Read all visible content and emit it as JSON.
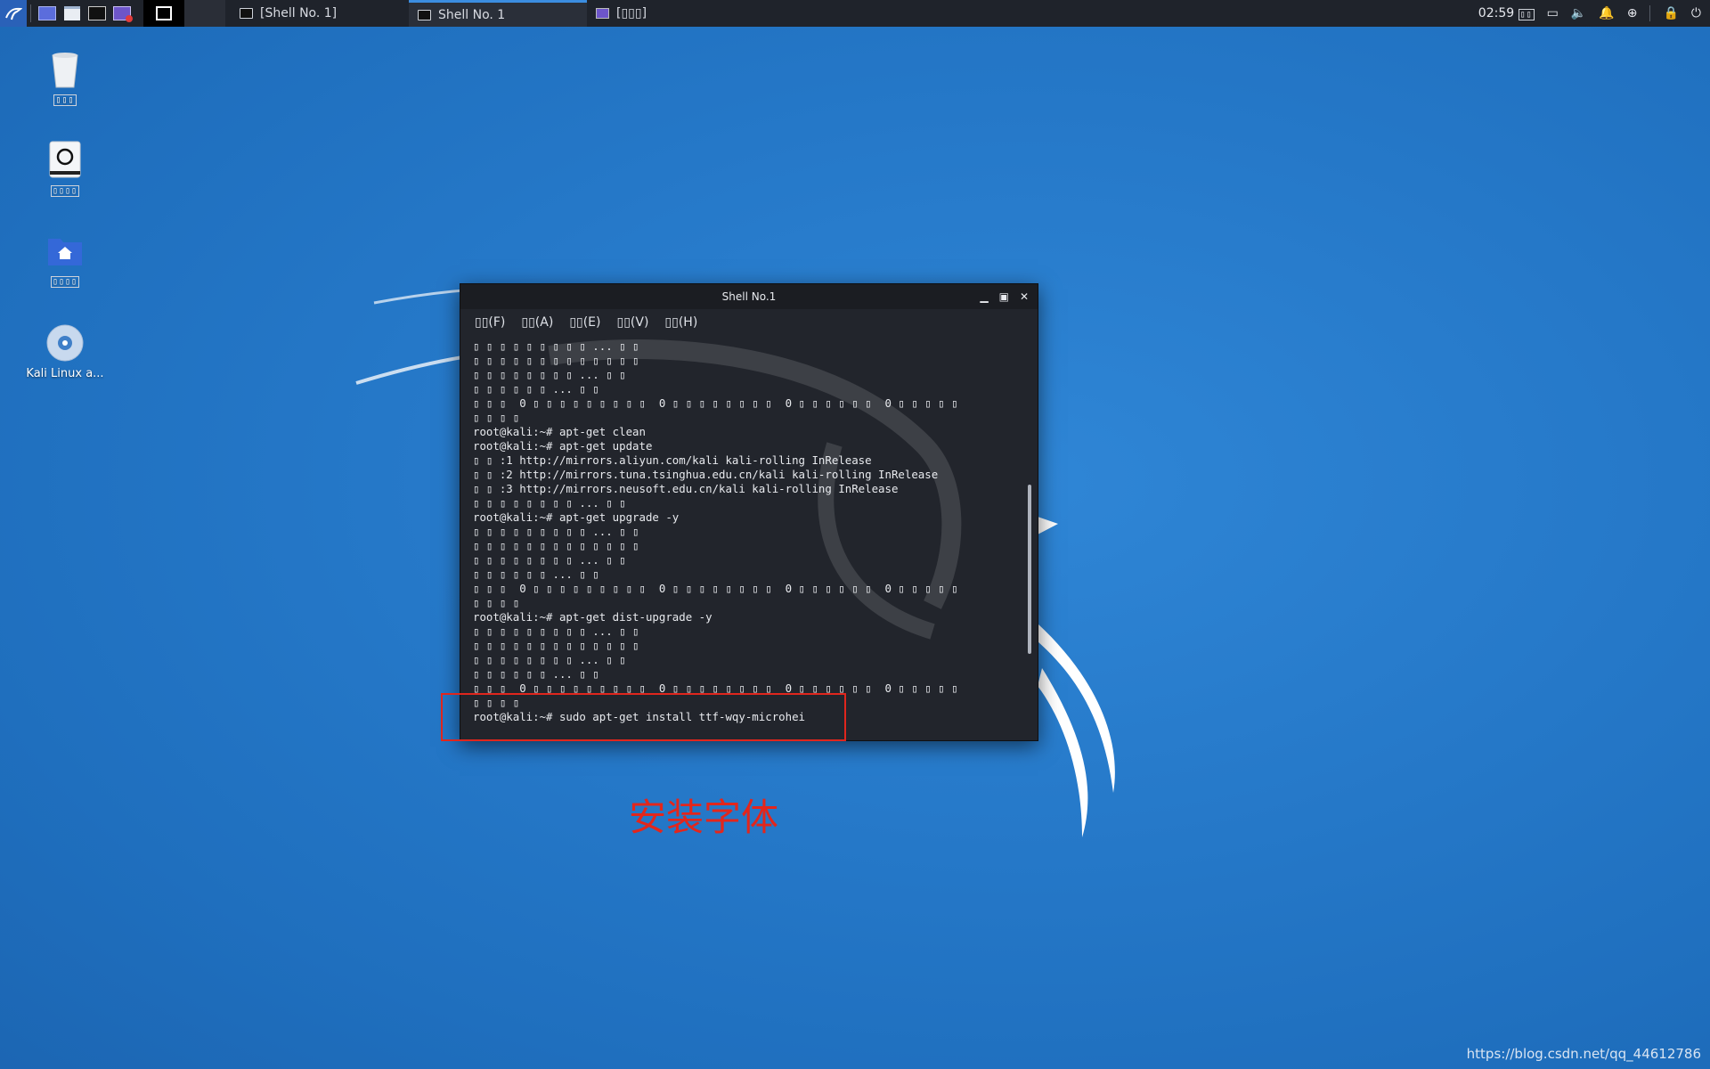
{
  "topbar": {
    "tasks": [
      {
        "label": "[Shell No. 1]",
        "icon": "terminal-icon"
      },
      {
        "label": "Shell No. 1",
        "icon": "terminal-icon"
      },
      {
        "label": "[▯▯▯]",
        "icon": "screen-icon"
      }
    ],
    "clock": "02:59",
    "clock_suffix": "▯▯"
  },
  "desktop": {
    "icons": [
      {
        "label": "▯▯▯",
        "icon": "trash-icon"
      },
      {
        "label": "▯▯▯▯",
        "icon": "drive-icon"
      },
      {
        "label": "▯▯▯▯",
        "icon": "home-folder-icon"
      },
      {
        "label": "Kali Linux a...",
        "icon": "disc-icon"
      }
    ]
  },
  "terminal": {
    "title": "Shell No.1",
    "menu": [
      "▯▯(F)",
      "▯▯(A)",
      "▯▯(E)",
      "▯▯(V)",
      "▯▯(H)"
    ],
    "lines": [
      "▯ ▯ ▯ ▯ ▯ ▯ ▯ ▯ ▯ ... ▯ ▯",
      "▯ ▯ ▯ ▯ ▯ ▯ ▯ ▯ ▯ ▯ ▯ ▯ ▯",
      "▯ ▯ ▯ ▯ ▯ ▯ ▯ ▯ ... ▯ ▯",
      "▯ ▯ ▯ ▯ ▯ ▯ ... ▯ ▯",
      "▯ ▯ ▯  0 ▯ ▯ ▯ ▯ ▯ ▯ ▯ ▯ ▯  0 ▯ ▯ ▯ ▯ ▯ ▯ ▯ ▯  0 ▯ ▯ ▯ ▯ ▯ ▯  0 ▯ ▯ ▯ ▯ ▯",
      "▯ ▯ ▯ ▯",
      "root@kali:~# apt-get clean",
      "root@kali:~# apt-get update",
      "▯ ▯ :1 http://mirrors.aliyun.com/kali kali-rolling InRelease",
      "▯ ▯ :2 http://mirrors.tuna.tsinghua.edu.cn/kali kali-rolling InRelease",
      "▯ ▯ :3 http://mirrors.neusoft.edu.cn/kali kali-rolling InRelease",
      "▯ ▯ ▯ ▯ ▯ ▯ ▯ ▯ ... ▯ ▯",
      "root@kali:~# apt-get upgrade -y",
      "▯ ▯ ▯ ▯ ▯ ▯ ▯ ▯ ▯ ... ▯ ▯",
      "▯ ▯ ▯ ▯ ▯ ▯ ▯ ▯ ▯ ▯ ▯ ▯ ▯",
      "▯ ▯ ▯ ▯ ▯ ▯ ▯ ▯ ... ▯ ▯",
      "▯ ▯ ▯ ▯ ▯ ▯ ... ▯ ▯",
      "▯ ▯ ▯  0 ▯ ▯ ▯ ▯ ▯ ▯ ▯ ▯ ▯  0 ▯ ▯ ▯ ▯ ▯ ▯ ▯ ▯  0 ▯ ▯ ▯ ▯ ▯ ▯  0 ▯ ▯ ▯ ▯ ▯",
      "▯ ▯ ▯ ▯",
      "root@kali:~# apt-get dist-upgrade -y",
      "▯ ▯ ▯ ▯ ▯ ▯ ▯ ▯ ▯ ... ▯ ▯",
      "▯ ▯ ▯ ▯ ▯ ▯ ▯ ▯ ▯ ▯ ▯ ▯ ▯",
      "▯ ▯ ▯ ▯ ▯ ▯ ▯ ▯ ... ▯ ▯",
      "▯ ▯ ▯ ▯ ▯ ▯ ... ▯ ▯",
      "▯ ▯ ▯  0 ▯ ▯ ▯ ▯ ▯ ▯ ▯ ▯ ▯  0 ▯ ▯ ▯ ▯ ▯ ▯ ▯ ▯  0 ▯ ▯ ▯ ▯ ▯ ▯  0 ▯ ▯ ▯ ▯ ▯",
      "▯ ▯ ▯ ▯",
      "root@kali:~# sudo apt-get install ttf-wqy-microhei"
    ]
  },
  "annotation": {
    "text": "安装字体",
    "color": "#e3261c"
  },
  "watermark": "https://blog.csdn.net/qq_44612786"
}
